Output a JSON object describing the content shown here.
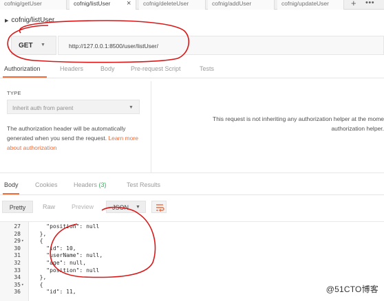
{
  "tabs": [
    {
      "label": "cofnig/getUser",
      "active": false
    },
    {
      "label": "cofnig/listUser",
      "active": true
    },
    {
      "label": "cofnig/deleteUser",
      "active": false
    },
    {
      "label": "cofnig/addUser",
      "active": false
    },
    {
      "label": "cofnig/updateUser",
      "active": false
    }
  ],
  "tab_close": "×",
  "new_tab": "+",
  "more_tabs": "•••",
  "request": {
    "title": "cofnig/listUser",
    "method": "GET",
    "url": "http://127.0.0.1:8500/user/listUser/"
  },
  "request_tabs": [
    "Authorization",
    "Headers",
    "Body",
    "Pre-request Script",
    "Tests"
  ],
  "auth": {
    "type_label": "TYPE",
    "selected": "Inherit auth from parent",
    "description": "The authorization header will be automatically generated when you send the request.",
    "link": "Learn more about authorization",
    "inherit_line1": "This request is not inheriting any authorization helper at the mome",
    "inherit_line2": "authorization helper."
  },
  "response_tabs": {
    "body": "Body",
    "cookies": "Cookies",
    "headers": "Headers",
    "headers_count": "(3)",
    "test_results": "Test Results"
  },
  "format": {
    "pretty": "Pretty",
    "raw": "Raw",
    "preview": "Preview",
    "json": "JSON"
  },
  "code_lines": [
    {
      "num": "27",
      "fold": "",
      "text": "    \"position\": null"
    },
    {
      "num": "28",
      "fold": "",
      "text": "  },"
    },
    {
      "num": "29",
      "fold": "▾",
      "text": "  {"
    },
    {
      "num": "30",
      "fold": "",
      "text": "    \"id\": 10,"
    },
    {
      "num": "31",
      "fold": "",
      "text": "    \"userName\": null,"
    },
    {
      "num": "32",
      "fold": "",
      "text": "    \"age\": null,"
    },
    {
      "num": "33",
      "fold": "",
      "text": "    \"position\": null"
    },
    {
      "num": "34",
      "fold": "",
      "text": "  },"
    },
    {
      "num": "35",
      "fold": "▾",
      "text": "  {"
    },
    {
      "num": "36",
      "fold": "",
      "text": "    \"id\": 11,"
    }
  ],
  "watermark": "@51CTO博客",
  "colors": {
    "accent": "#f26b3a",
    "count_green": "#3cab5c",
    "annotation_red": "#d81818"
  }
}
